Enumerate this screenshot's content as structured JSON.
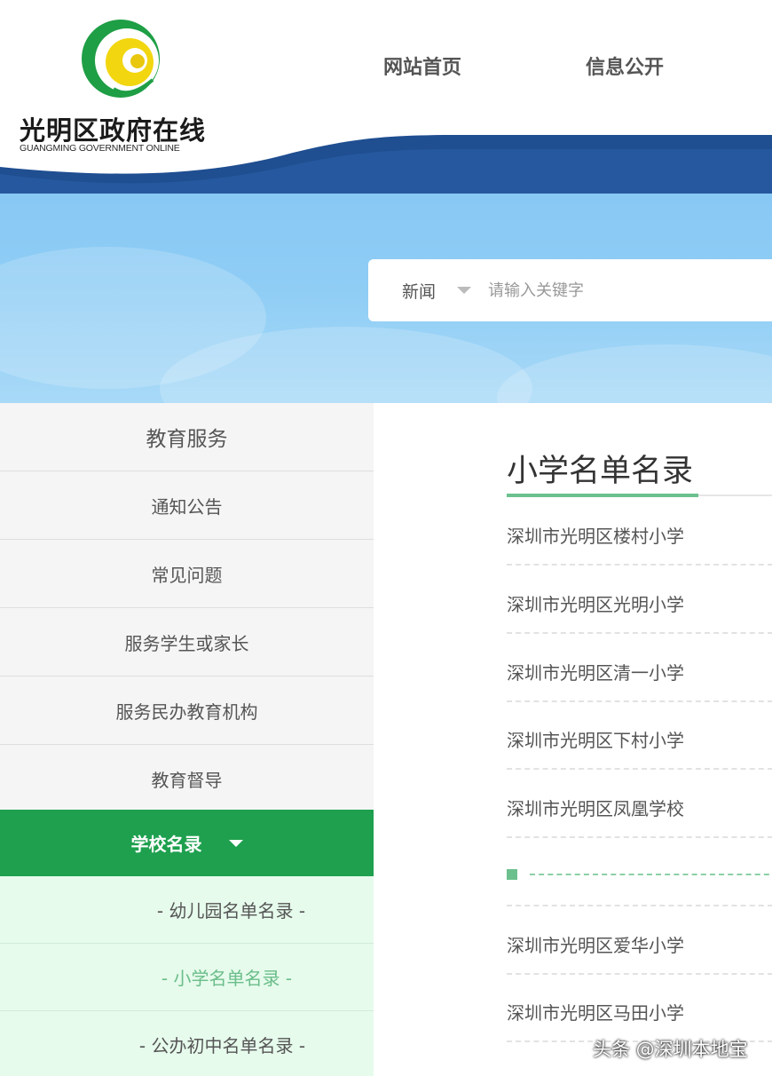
{
  "header": {
    "logo_title": "光明区政府在线",
    "logo_subtitle": "GUANGMING GOVERNMENT ONLINE",
    "logo_icon": "guangming-emblem-icon",
    "nav": [
      {
        "label": "网站首页"
      },
      {
        "label": "信息公开"
      }
    ]
  },
  "search": {
    "category": "新闻",
    "placeholder": "请输入关键字",
    "value": ""
  },
  "sidebar": {
    "heading": "教育服务",
    "items": [
      {
        "label": "通知公告"
      },
      {
        "label": "常见问题"
      },
      {
        "label": "服务学生或家长"
      },
      {
        "label": "服务民办教育机构"
      },
      {
        "label": "教育督导"
      }
    ],
    "active": {
      "label": "学校名录"
    },
    "subitems": [
      {
        "label": "- 幼儿园名单名录 -"
      },
      {
        "label": "- 小学名单名录 -"
      },
      {
        "label": "- 公办初中名单名录 -"
      }
    ]
  },
  "main": {
    "title": "小学名单名录",
    "list": [
      {
        "label": "深圳市光明区楼村小学"
      },
      {
        "label": "深圳市光明区光明小学"
      },
      {
        "label": "深圳市光明区清一小学"
      },
      {
        "label": "深圳市光明区下村小学"
      },
      {
        "label": "深圳市光明区凤凰学校"
      },
      {
        "label": "深圳市光明区爱华小学"
      },
      {
        "label": "深圳市光明区马田小学"
      }
    ]
  },
  "watermark": "头条 @深圳本地宝",
  "colors": {
    "brand_blue": "#1f4e91",
    "sidebar_active": "#1ea04e",
    "submenu_bg": "#e6fbec",
    "accent_green": "#6cc08d",
    "banner_sky": "#8fcdf5"
  }
}
